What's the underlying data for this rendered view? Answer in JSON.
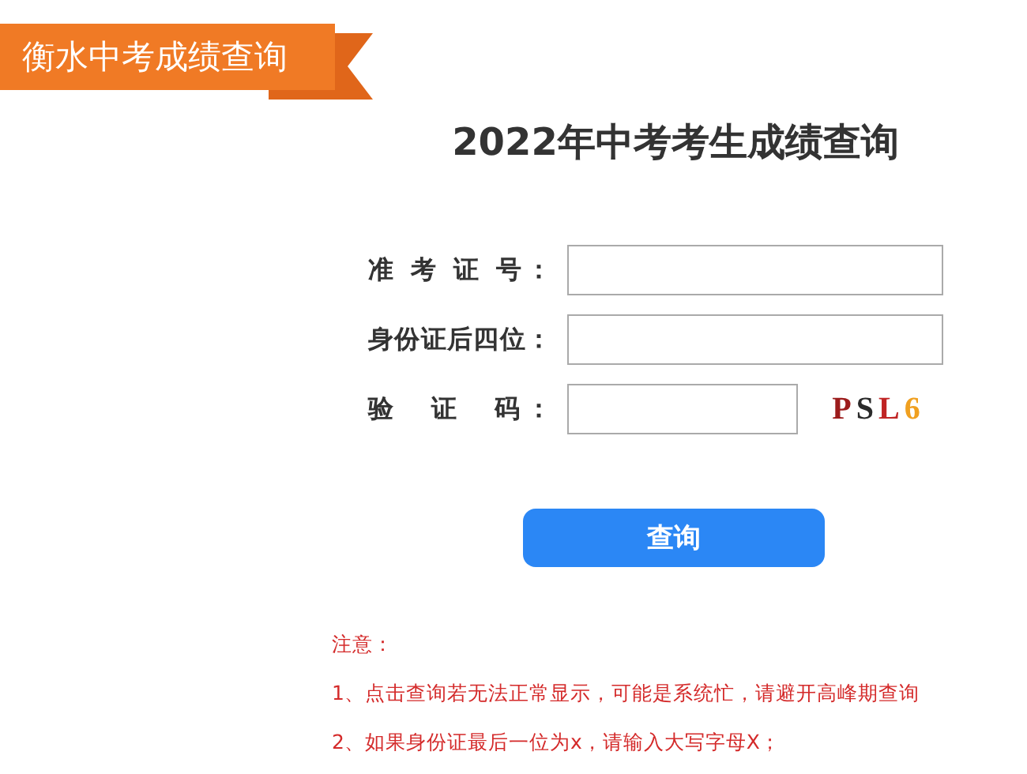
{
  "banner": {
    "title": "衡水中考成绩查询"
  },
  "heading": "2022年中考考生成绩查询",
  "fields": [
    {
      "label": "准 考 证 号：",
      "kind": "text"
    },
    {
      "label": "身份证后四位：",
      "kind": "text"
    },
    {
      "label": "验　证　码：",
      "kind": "captcha"
    }
  ],
  "captcha": {
    "chars": [
      {
        "char": "P",
        "color": "#9c1c1c"
      },
      {
        "char": "S",
        "color": "#2a2a2a"
      },
      {
        "char": "L",
        "color": "#c02424"
      },
      {
        "char": "6",
        "color": "#f0a020"
      }
    ]
  },
  "submit": "查询",
  "notes": [
    "注意：",
    "1、点击查询若无法正常显示，可能是系统忙，请避开高峰期查询",
    "2、如果身份证最后一位为x，请输入大写字母X；"
  ]
}
